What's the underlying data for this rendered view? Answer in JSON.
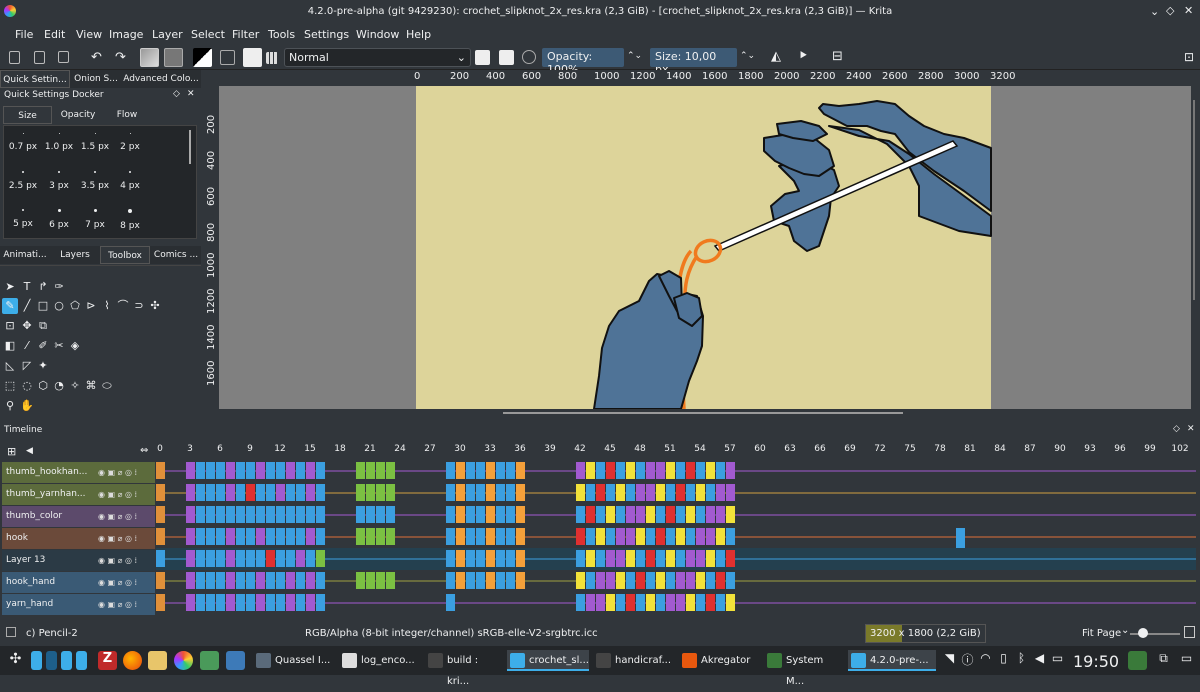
{
  "window": {
    "title": "4.2.0-pre-alpha (git 9429230): crochet_slipknot_2x_res.kra (2,3 GiB) - [crochet_slipknot_2x_res.kra (2,3 GiB)] — Krita"
  },
  "menu": [
    "File",
    "Edit",
    "View",
    "Image",
    "Layer",
    "Select",
    "Filter",
    "Tools",
    "Settings",
    "Window",
    "Help"
  ],
  "toolbar": {
    "blend_mode": "Normal",
    "opacity_label": "Opacity:",
    "opacity_value": "100%",
    "size_label": "Size:",
    "size_value": "10,00 px"
  },
  "top_tabs": [
    "Quick Settin...",
    "Onion S...",
    "Advanced Colo..."
  ],
  "quick_settings": {
    "title": "Quick Settings Docker",
    "tabs": [
      "Size",
      "Opacity",
      "Flow"
    ],
    "sizes": [
      "0.7 px",
      "1.0 px",
      "1.5 px",
      "2 px",
      "2.5 px",
      "3 px",
      "3.5 px",
      "4 px",
      "5 px",
      "6 px",
      "7 px",
      "8 px"
    ]
  },
  "mid_tabs": [
    "Animati...",
    "Layers",
    "Toolbox",
    "Comics ..."
  ],
  "ruler_top": [
    "0",
    "200",
    "400",
    "600",
    "800",
    "1000",
    "1200",
    "1400",
    "1600",
    "1800",
    "2000",
    "2200",
    "2400",
    "2600",
    "2800",
    "3000",
    "3200"
  ],
  "ruler_left": [
    "200",
    "400",
    "600",
    "800",
    "1000",
    "1200",
    "1400",
    "1600"
  ],
  "timeline": {
    "title": "Timeline",
    "frame_numbers": [
      "0",
      "3",
      "6",
      "9",
      "12",
      "15",
      "18",
      "21",
      "24",
      "27",
      "30",
      "33",
      "36",
      "39",
      "42",
      "45",
      "48",
      "51",
      "54",
      "57",
      "60",
      "63",
      "66",
      "69",
      "72",
      "75",
      "78",
      "81",
      "84",
      "87",
      "90",
      "93",
      "96",
      "99",
      "102"
    ],
    "layers": [
      {
        "name": "thumb_hookhan...",
        "color": "#5c6b3c"
      },
      {
        "name": "thumb_yarnhan...",
        "color": "#5c6b3c"
      },
      {
        "name": "thumb_color",
        "color": "#5c4a6b"
      },
      {
        "name": "hook",
        "color": "#6b4a3a"
      },
      {
        "name": "Layer 13",
        "color": "#2b3a45"
      },
      {
        "name": "hook_hand",
        "color": "#3a5a75"
      },
      {
        "name": "yarn_hand",
        "color": "#3a5a75"
      }
    ]
  },
  "status": {
    "brush": "c) Pencil-2",
    "colorspace": "RGB/Alpha (8-bit integer/channel)  sRGB-elle-V2-srgbtrc.icc",
    "dimensions": "3200 x 1800 (2,2 GiB)",
    "zoom": "Fit Page"
  },
  "taskbar": {
    "tasks": [
      "Quassel I...",
      "log_enco...",
      "build : kri...",
      "crochet_sl...",
      "handicraf...",
      "Akregator",
      "System M...",
      "4.2.0-pre-..."
    ],
    "clock": "19:50"
  },
  "colors": {
    "accent": "#3daee9",
    "canvas_bg": "#ddd49a",
    "hand": "#4f7397",
    "hook_orange": "#f07a1e"
  }
}
